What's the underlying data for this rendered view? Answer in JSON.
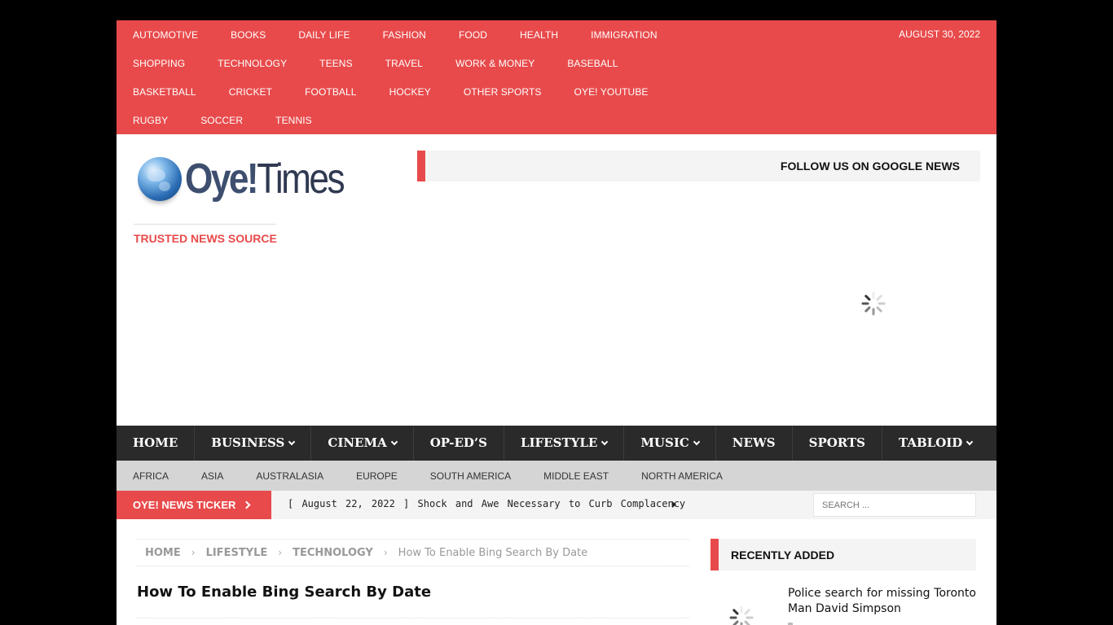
{
  "top_menu": {
    "rows": [
      [
        "AUTOMOTIVE",
        "BOOKS",
        "DAILY LIFE",
        "FASHION",
        "FOOD",
        "HEALTH",
        "IMMIGRATION"
      ],
      [
        "SHOPPING",
        "TECHNOLOGY",
        "TEENS",
        "TRAVEL",
        "WORK & MONEY",
        "BASEBALL"
      ],
      [
        "BASKETBALL",
        "CRICKET",
        "FOOTBALL",
        "HOCKEY",
        "OTHER SPORTS",
        "OYE! YOUTUBE"
      ],
      [
        "RUGBY",
        "SOCCER",
        "TENNIS"
      ]
    ],
    "date": "AUGUST 30, 2022"
  },
  "header": {
    "logo_text_oye": "Oye!",
    "logo_text_times": "Times",
    "tagline": "TRUSTED NEWS SOURCE",
    "follow_label": "FOLLOW US ON GOOGLE NEWS"
  },
  "main_nav": [
    {
      "label": "HOME",
      "dropdown": false
    },
    {
      "label": "BUSINESS",
      "dropdown": true
    },
    {
      "label": "CINEMA",
      "dropdown": true
    },
    {
      "label": "OP-ED’S",
      "dropdown": false
    },
    {
      "label": "LIFESTYLE",
      "dropdown": true
    },
    {
      "label": "MUSIC",
      "dropdown": true
    },
    {
      "label": "NEWS",
      "dropdown": false
    },
    {
      "label": "SPORTS",
      "dropdown": false
    },
    {
      "label": "TABLOID",
      "dropdown": true
    }
  ],
  "sub_nav": [
    "AFRICA",
    "ASIA",
    "AUSTRALASIA",
    "EUROPE",
    "SOUTH AMERICA",
    "MIDDLE EAST",
    "NORTH AMERICA"
  ],
  "ticker": {
    "label": "OYE! NEWS TICKER",
    "item": "[ August 22, 2022 ] Shock and Awe Necessary to Curb Complacency",
    "search_placeholder": "SEARCH ..."
  },
  "breadcrumb": {
    "items": [
      "HOME",
      "LIFESTYLE",
      "TECHNOLOGY"
    ],
    "current": "How To Enable Bing Search By Date"
  },
  "page_title": "How To Enable Bing Search By Date",
  "sidebar": {
    "recent_title": "RECENTLY ADDED",
    "recent_item": "Police search for missing Toronto Man David Simpson"
  },
  "colors": {
    "accent": "#e84a4b",
    "nav_dark": "#2a2a2a",
    "subnav_gray": "#d5d5d5"
  }
}
